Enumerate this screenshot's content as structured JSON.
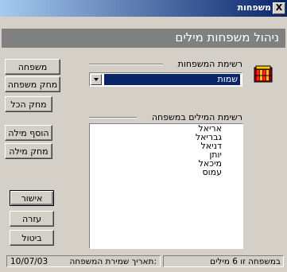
{
  "window": {
    "title": "משפחות",
    "close_label": "X"
  },
  "header": {
    "title": "ניהול משפחות מילים"
  },
  "buttons": {
    "new_family": "משפחה חדשה",
    "delete_family": "מחק משפחה",
    "delete_all": "מחק הכל",
    "add_word": "הוסף מילה",
    "delete_word": "מחק מילה",
    "ok": "אישור",
    "help": "עזרה",
    "cancel": "ביטול"
  },
  "families": {
    "label": "רשימת המשפחות",
    "selected": "שמות"
  },
  "words": {
    "label": "רשימת המילים במשפחה",
    "items": [
      "אריאל",
      "גבריאל",
      "דניאל",
      "יותן",
      "מיכאל",
      "עמוס"
    ]
  },
  "status": {
    "word_count": "במשפחה זו 6 מילים",
    "save_date_label": "תאריך שמירת המשפחה:",
    "save_date": "10/07/03"
  },
  "icons": {
    "app": "book-shelf-icon",
    "close": "close-icon",
    "dropdown": "chevron-down-icon"
  },
  "colors": {
    "title_start": "#a6caf0",
    "title_end": "#0a246a",
    "header_bg": "#808080",
    "selection": "#0a246a",
    "face": "#d4d0c8"
  }
}
